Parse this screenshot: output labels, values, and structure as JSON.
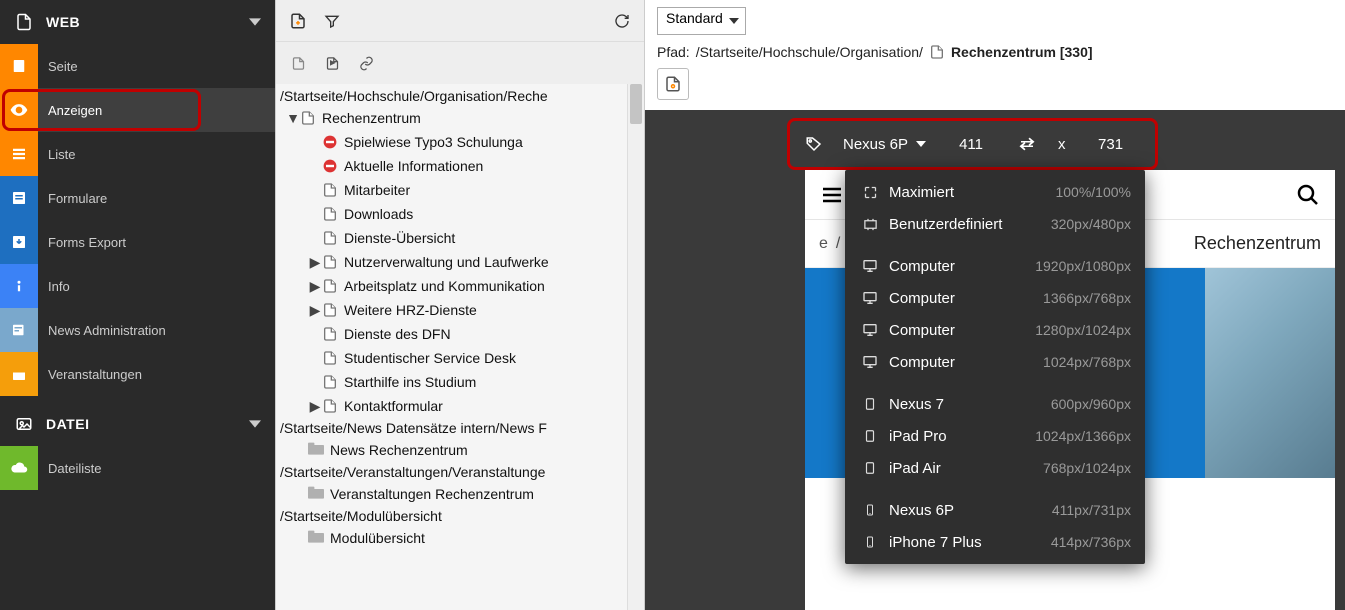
{
  "sidebar": {
    "group_web": "WEB",
    "group_file": "DATEI",
    "items": [
      {
        "label": "Seite"
      },
      {
        "label": "Anzeigen"
      },
      {
        "label": "Liste"
      },
      {
        "label": "Formulare"
      },
      {
        "label": "Forms Export"
      },
      {
        "label": "Info"
      },
      {
        "label": "News Administration"
      },
      {
        "label": "Veranstaltungen"
      }
    ],
    "file_items": [
      {
        "label": "Dateiliste"
      }
    ]
  },
  "page_tree": {
    "path0": "/Startseite/Hochschule/Organisation/Reche",
    "root": "Rechenzentrum",
    "children": [
      {
        "label": "Spielwiese Typo3 Schulunga",
        "restricted": true
      },
      {
        "label": "Aktuelle Informationen",
        "restricted": true
      },
      {
        "label": "Mitarbeiter"
      },
      {
        "label": "Downloads"
      },
      {
        "label": "Dienste-Übersicht"
      },
      {
        "label": "Nutzerverwaltung und Laufwerke",
        "hasChildren": true
      },
      {
        "label": "Arbeitsplatz und Kommunikation",
        "hasChildren": true
      },
      {
        "label": "Weitere HRZ-Dienste",
        "hasChildren": true
      },
      {
        "label": "Dienste des DFN"
      },
      {
        "label": "Studentischer Service Desk"
      },
      {
        "label": "Starthilfe ins Studium"
      },
      {
        "label": "Kontaktformular",
        "hasChildren": true
      }
    ],
    "path1": "/Startseite/News Datensätze intern/News F",
    "folder1": "News Rechenzentrum",
    "path2": "/Startseite/Veranstaltungen/Veranstaltunge",
    "folder2": "Veranstaltungen Rechenzentrum",
    "path3": "/Startseite/Modulübersicht",
    "folder3": "Modulübersicht"
  },
  "content": {
    "page_type": "Standard",
    "path_prefix": "Pfad: ",
    "path": "/Startseite/Hochschule/Organisation/",
    "page_title": "Rechenzentrum [330]",
    "device_name": "Nexus 6P",
    "width": "411",
    "height": "731",
    "x": "x",
    "breadcrumb_last_visible": "e",
    "breadcrumb_sep": "/",
    "breadcrumb_current": "Rechenzentrum"
  },
  "presets": [
    {
      "icon": "maximize",
      "label": "Maximiert",
      "dim": "100%/100%"
    },
    {
      "icon": "custom",
      "label": "Benutzerdefiniert",
      "dim": "320px/480px"
    },
    {
      "sep": true
    },
    {
      "icon": "desktop",
      "label": "Computer",
      "dim": "1920px/1080px"
    },
    {
      "icon": "desktop",
      "label": "Computer",
      "dim": "1366px/768px"
    },
    {
      "icon": "desktop",
      "label": "Computer",
      "dim": "1280px/1024px"
    },
    {
      "icon": "desktop",
      "label": "Computer",
      "dim": "1024px/768px"
    },
    {
      "sep": true
    },
    {
      "icon": "tablet",
      "label": "Nexus 7",
      "dim": "600px/960px"
    },
    {
      "icon": "tablet",
      "label": "iPad Pro",
      "dim": "1024px/1366px"
    },
    {
      "icon": "tablet",
      "label": "iPad Air",
      "dim": "768px/1024px"
    },
    {
      "sep": true
    },
    {
      "icon": "phone",
      "label": "Nexus 6P",
      "dim": "411px/731px"
    },
    {
      "icon": "phone",
      "label": "iPhone 7 Plus",
      "dim": "414px/736px"
    }
  ]
}
